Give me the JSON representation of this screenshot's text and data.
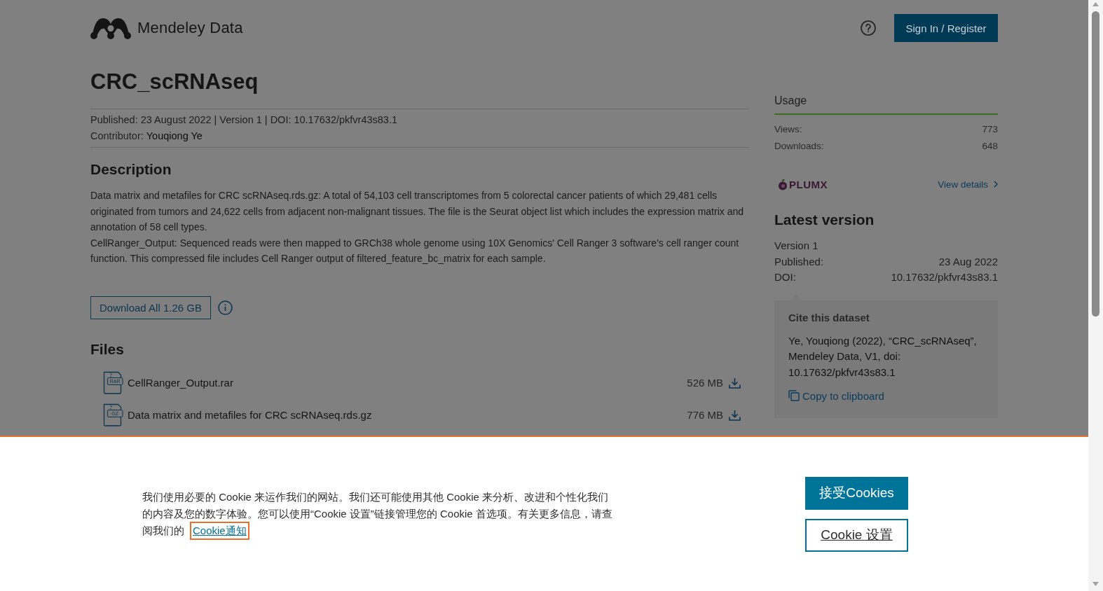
{
  "header": {
    "logo_text": "Mendeley Data",
    "sign_in_button": "Sign In / Register"
  },
  "dataset": {
    "title": "CRC_scRNAseq",
    "meta": "Published: 23 August 2022 | Version 1 | DOI: 10.17632/pkfvr43s83.1",
    "contributor_label": "Contributor:",
    "contributor": "Youqiong Ye"
  },
  "description": {
    "heading": "Description",
    "paragraphs": [
      "Data matrix and metafiles for CRC scRNAseq.rds.gz: A total of 54,103 cell transcriptomes from 5 colorectal cancer patients of which 29,481 cells originated from tumors and 24,622 cells from adjacent non-malignant tissues. The file is the Seurat object list which includes the expression matrix and annotation of 58 cell types.",
      "CellRanger_Output: Sequenced reads were then mapped to GRCh38 whole genome using 10X Genomics' Cell Ranger 3 software's cell ranger count function. This compressed file includes Cell Ranger output of filtered_feature_bc_matrix for each sample."
    ]
  },
  "download_all_button": "Download All 1.26 GB",
  "files": {
    "heading": "Files",
    "items": [
      {
        "name": "CellRanger_Output.rar",
        "type_label": "RAR",
        "size": "526 MB"
      },
      {
        "name": "Data matrix and metafiles for CRC scRNAseq.rds.gz",
        "type_label": "GZ",
        "size": "776 MB"
      }
    ]
  },
  "sidebar": {
    "usage": {
      "heading": "Usage",
      "stats": [
        {
          "label": "Views:",
          "value": "773"
        },
        {
          "label": "Downloads:",
          "value": "648"
        }
      ]
    },
    "plumx": {
      "logo_text": "PLUMX",
      "link": "View details"
    },
    "latest_version": {
      "heading": "Latest version",
      "version": "Version 1",
      "rows": [
        {
          "label": "Published:",
          "value": "23 Aug 2022"
        },
        {
          "label": "DOI:",
          "value": "10.17632/pkfvr43s83.1"
        }
      ]
    },
    "cite": {
      "heading": "Cite this dataset",
      "text": "Ye, Youqiong (2022), “CRC_scRNAseq”, Mendeley Data, V1, doi: 10.17632/pkfvr43s83.1",
      "copy_link": "Copy to clipboard"
    }
  },
  "cookie_banner": {
    "text": "我们使用必要的 Cookie 来运作我们的网站。我们还可能使用其他 Cookie 来分析、改进和个性化我们的内容及您的数字体验。您可以使用“Cookie 设置”链接管理您的 Cookie 首选项。有关更多信息，请查阅我们的",
    "link": {
      "text": "Cookie通知",
      "focused": true
    },
    "accept_button": "接受Cookies",
    "settings_button": "Cookie 设置"
  }
}
